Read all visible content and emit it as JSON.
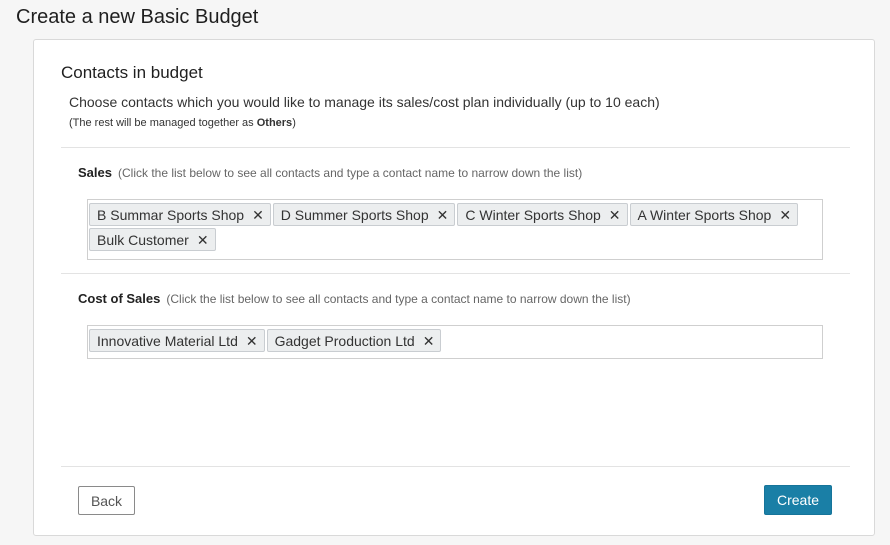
{
  "page": {
    "title": "Create a new Basic Budget"
  },
  "section": {
    "title": "Contacts in budget",
    "intro": "Choose contacts which you would like to manage its sales/cost plan individually (up to 10 each)",
    "note_prefix": "(The rest will be managed together as ",
    "note_bold": "Others",
    "note_suffix": ")"
  },
  "sales": {
    "label": "Sales",
    "hint": "(Click the list below to see all contacts and type a contact name to narrow down the list)",
    "tags": [
      "B Summar Sports Shop",
      "D Summer Sports Shop",
      "C Winter Sports Shop",
      "A Winter Sports Shop",
      "Bulk Customer"
    ]
  },
  "cost_of_sales": {
    "label": "Cost of Sales",
    "hint": "(Click the list below to see all contacts and type a contact name to narrow down the list)",
    "tags": [
      "Innovative Material Ltd",
      "Gadget Production Ltd"
    ]
  },
  "remove_icon": "close-icon",
  "remove_glyph": "✕",
  "buttons": {
    "back": "Back",
    "create": "Create"
  },
  "colors": {
    "primary": "#1a7fa6",
    "tag_bg": "#eceeef"
  }
}
